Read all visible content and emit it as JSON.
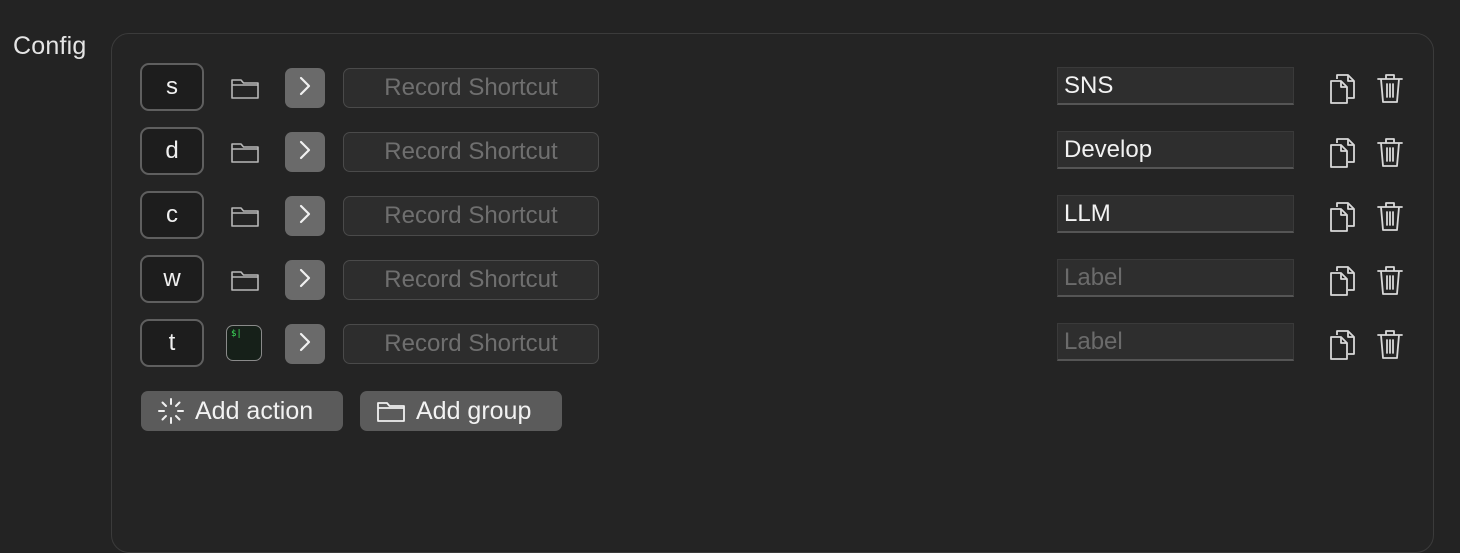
{
  "section": {
    "label": "Config"
  },
  "rows": [
    {
      "key": "s",
      "type": "folder",
      "record_label": "Record Shortcut",
      "label_value": "SNS",
      "label_placeholder": "Label"
    },
    {
      "key": "d",
      "type": "folder",
      "record_label": "Record Shortcut",
      "label_value": "Develop",
      "label_placeholder": "Label"
    },
    {
      "key": "c",
      "type": "folder",
      "record_label": "Record Shortcut",
      "label_value": "LLM",
      "label_placeholder": "Label"
    },
    {
      "key": "w",
      "type": "folder",
      "record_label": "Record Shortcut",
      "label_value": "",
      "label_placeholder": "Label"
    },
    {
      "key": "t",
      "type": "terminal",
      "terminal_glyph": "$|",
      "record_label": "Record Shortcut",
      "label_value": "",
      "label_placeholder": "Label"
    }
  ],
  "buttons": {
    "add_action": "Add action",
    "add_group": "Add group"
  },
  "icons": {
    "folder": "folder-icon",
    "chevron": "chevron-right-icon",
    "copy": "copy-icon",
    "trash": "trash-icon",
    "add_action": "sparkle-icon",
    "add_group": "folder-icon",
    "terminal": "terminal-app-icon"
  },
  "colors": {
    "background": "#232323",
    "panel_border": "#3b3b3b",
    "chevron_button": "#6a6a6a",
    "add_button": "#5b5b5b",
    "terminal_prompt": "#3ddc5a"
  }
}
